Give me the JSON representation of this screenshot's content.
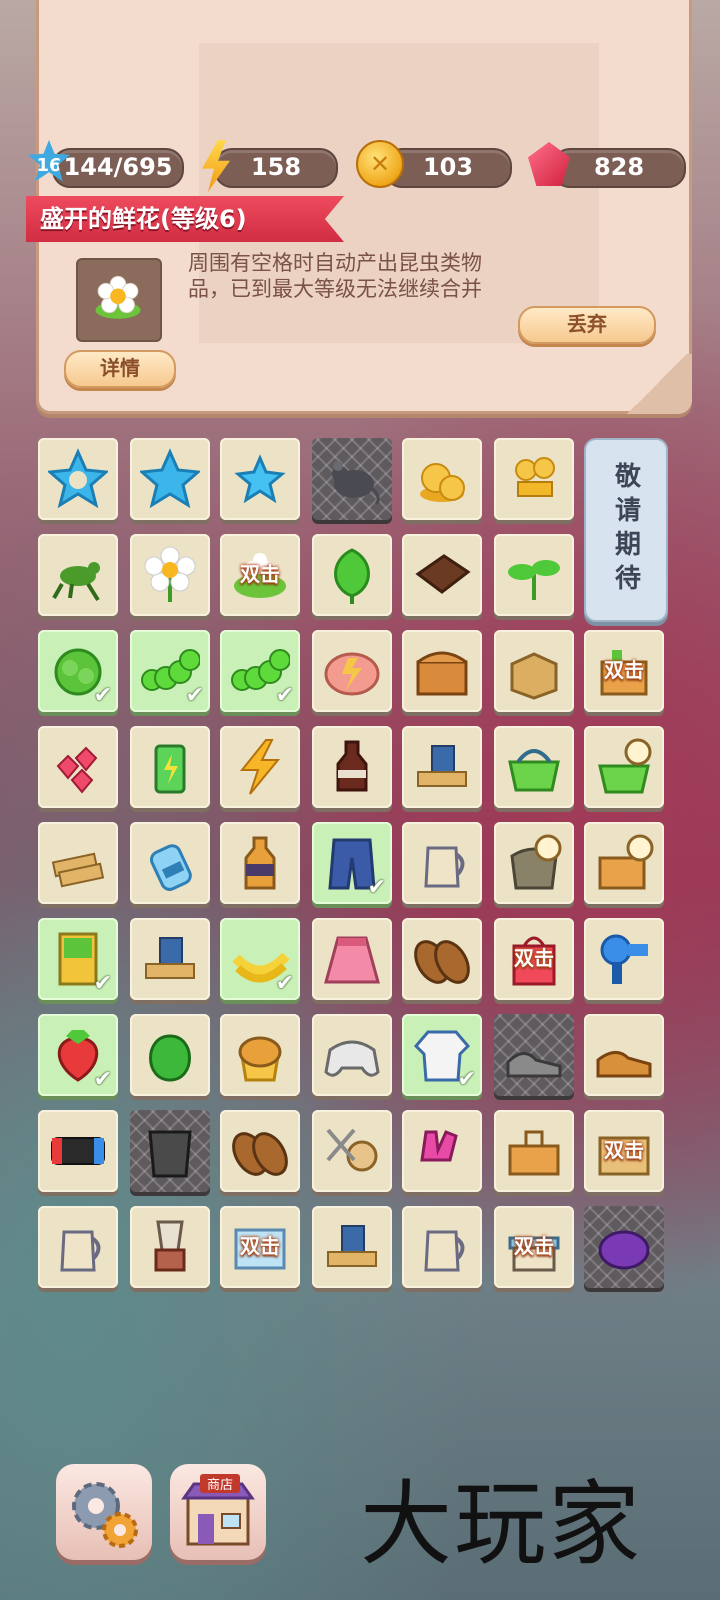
{
  "stats": {
    "level": "16",
    "xp": "144/695",
    "energy": "158",
    "coins": "103",
    "gems": "828"
  },
  "selected_item": {
    "title": "盛开的鲜花(等级6)",
    "description": "周围有空格时自动产出昆虫类物品，已到最大等级无法继续合并",
    "details_label": "详情",
    "discard_label": "丢弃"
  },
  "board": {
    "double_label": "双击",
    "coming_soon": "敬请期待",
    "rows": [
      [
        {
          "icon": "blue-star-outline-icon",
          "bg": "plain"
        },
        {
          "icon": "blue-star-icon",
          "bg": "plain"
        },
        {
          "icon": "small-blue-star-icon",
          "bg": "plain"
        },
        {
          "icon": "rat-icon",
          "bg": "web"
        },
        {
          "icon": "coins-pile-icon",
          "bg": "plain"
        },
        {
          "icon": "gold-bars-icon",
          "bg": "plain"
        }
      ],
      [
        {
          "icon": "grasshopper-icon",
          "bg": "plain"
        },
        {
          "icon": "daisy-icon",
          "bg": "plain"
        },
        {
          "icon": "flower-bush-icon",
          "bg": "plain",
          "double": true
        },
        {
          "icon": "leaf-icon",
          "bg": "plain"
        },
        {
          "icon": "chocolate-bar-icon",
          "bg": "plain"
        },
        {
          "icon": "sprout-icon",
          "bg": "plain"
        }
      ],
      [
        {
          "icon": "lettuce-icon",
          "bg": "green",
          "check": true
        },
        {
          "icon": "caterpillar-icon",
          "bg": "green",
          "check": true
        },
        {
          "icon": "caterpillar-icon",
          "bg": "green",
          "check": true
        },
        {
          "icon": "piggy-bank-icon",
          "bg": "plain"
        },
        {
          "icon": "treasure-chest-icon",
          "bg": "plain"
        },
        {
          "icon": "cardboard-box-icon",
          "bg": "plain"
        },
        {
          "icon": "gift-box-icon",
          "bg": "plain",
          "double": true
        }
      ],
      [
        {
          "icon": "ruby-gems-icon",
          "bg": "plain"
        },
        {
          "icon": "battery-icon",
          "bg": "plain"
        },
        {
          "icon": "lightning-icon",
          "bg": "plain"
        },
        {
          "icon": "cola-bottle-icon",
          "bg": "plain"
        },
        {
          "icon": "stationery-icon",
          "bg": "plain"
        },
        {
          "icon": "green-basket-icon",
          "bg": "plain"
        },
        {
          "icon": "basket-timer-icon",
          "bg": "plain"
        }
      ],
      [
        {
          "icon": "biscuits-icon",
          "bg": "plain"
        },
        {
          "icon": "water-bottle-icon",
          "bg": "plain"
        },
        {
          "icon": "juice-bottle-icon",
          "bg": "plain"
        },
        {
          "icon": "jeans-icon",
          "bg": "green",
          "check": true
        },
        {
          "icon": "kettle-icon",
          "bg": "plain"
        },
        {
          "icon": "flour-sack-timer-icon",
          "bg": "plain"
        },
        {
          "icon": "supply-box-timer-icon",
          "bg": "plain"
        }
      ],
      [
        {
          "icon": "seed-packet-icon",
          "bg": "green",
          "check": true
        },
        {
          "icon": "stationery-icon",
          "bg": "plain"
        },
        {
          "icon": "bananas-icon",
          "bg": "green",
          "check": true
        },
        {
          "icon": "pink-skirt-icon",
          "bg": "plain"
        },
        {
          "icon": "sandals-icon",
          "bg": "plain"
        },
        {
          "icon": "shopping-bag-icon",
          "bg": "plain",
          "double": true
        },
        {
          "icon": "hair-dryer-icon",
          "bg": "plain"
        }
      ],
      [
        {
          "icon": "strawberry-icon",
          "bg": "green",
          "check": true
        },
        {
          "icon": "green-pepper-icon",
          "bg": "plain"
        },
        {
          "icon": "muffin-icon",
          "bg": "plain"
        },
        {
          "icon": "gamepad-icon",
          "bg": "plain"
        },
        {
          "icon": "polo-shirt-icon",
          "bg": "green",
          "check": true
        },
        {
          "icon": "sneakers-icon",
          "bg": "web"
        },
        {
          "icon": "leather-shoes-icon",
          "bg": "plain"
        }
      ],
      [
        {
          "icon": "game-console-icon",
          "bg": "plain"
        },
        {
          "icon": "trash-bin-icon",
          "bg": "web"
        },
        {
          "icon": "sandals-icon",
          "bg": "plain"
        },
        {
          "icon": "sewing-kit-icon",
          "bg": "plain"
        },
        {
          "icon": "gloves-icon",
          "bg": "plain"
        },
        {
          "icon": "toolbox-icon",
          "bg": "plain"
        },
        {
          "icon": "package-icon",
          "bg": "plain",
          "double": true
        }
      ],
      [
        {
          "icon": "kettle-icon",
          "bg": "plain"
        },
        {
          "icon": "blender-icon",
          "bg": "plain"
        },
        {
          "icon": "ice-crate-icon",
          "bg": "plain",
          "double": true
        },
        {
          "icon": "stationery-icon",
          "bg": "plain"
        },
        {
          "icon": "kettle-icon",
          "bg": "plain"
        },
        {
          "icon": "market-stall-icon",
          "bg": "plain",
          "double": true
        },
        {
          "icon": "purple-cushion-icon",
          "bg": "web"
        }
      ]
    ]
  },
  "bottom_bar": {
    "shop_sign": "商店",
    "watermark": "大玩家"
  }
}
